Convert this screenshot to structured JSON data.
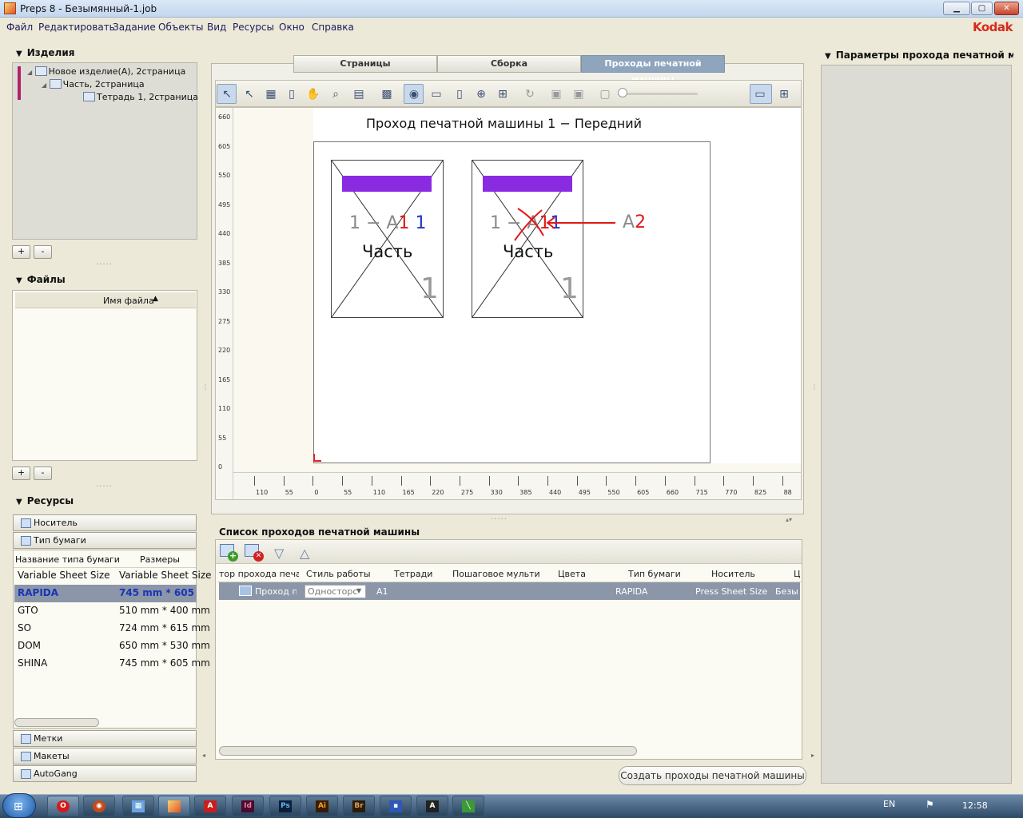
{
  "window": {
    "title": "Preps 8 - Безымянный-1.job"
  },
  "menu": [
    "Файл",
    "Редактировать",
    "Задание",
    "Объекты",
    "Вид",
    "Ресурсы",
    "Окно",
    "Справка"
  ],
  "brand": "Kodak",
  "products": {
    "title": "Изделия",
    "tree": [
      "Новое изделие(A), 2страница",
      "Часть, 2страница",
      "Тетрадь 1, 2страница"
    ],
    "add_label": "+",
    "remove_label": "-"
  },
  "files": {
    "title": "Файлы",
    "column": "Имя файла",
    "add_label": "+",
    "remove_label": "-"
  },
  "resources": {
    "title": "Ресурсы",
    "sections": [
      "Носитель",
      "Тип бумаги",
      "Метки",
      "Макеты",
      "AutoGang"
    ],
    "paper_columns": [
      "Название типа бумаги",
      "Размеры"
    ],
    "paper_types": [
      {
        "name": "Variable Sheet Size",
        "size": "Variable Sheet Size"
      },
      {
        "name": "RAPIDA",
        "size": "745 mm * 605 mm"
      },
      {
        "name": "GTO",
        "size": "510 mm * 400 mm"
      },
      {
        "name": "SO",
        "size": "724 mm * 615 mm"
      },
      {
        "name": "DOM",
        "size": "650 mm * 530 mm"
      },
      {
        "name": "SHINA",
        "size": "745 mm * 605 mm"
      }
    ],
    "selected_paper_index": 1
  },
  "tabs": [
    "Страницы",
    "Сборка",
    "Проходы печатной машины"
  ],
  "active_tab": 2,
  "canvas": {
    "heading": "Проход печатной машины 1 − Передний",
    "pages": [
      {
        "label_gray": "1 − A",
        "label_red": "1",
        "label_blue": "1",
        "part": "Часть",
        "number": "1"
      },
      {
        "label_gray": "1 − A",
        "label_red": "1",
        "label_blue": "1",
        "part": "Часть",
        "number": "1"
      }
    ],
    "annotation": {
      "prefix": "A",
      "value": "2"
    },
    "vertical_ruler": [
      "660",
      "605",
      "550",
      "495",
      "440",
      "385",
      "330",
      "275",
      "220",
      "165",
      "110",
      "55",
      "0"
    ],
    "horizontal_ruler": [
      "110",
      "55",
      "0",
      "55",
      "110",
      "165",
      "220",
      "275",
      "330",
      "385",
      "440",
      "495",
      "550",
      "605",
      "660",
      "715",
      "770",
      "825",
      "88"
    ]
  },
  "press_runs": {
    "title": "Список проходов печатной машины",
    "columns": [
      "тор прохода печати",
      "Стиль работы",
      "Тетради",
      "Пошаговое мульти",
      "Цвета",
      "Тип бумаги",
      "Носитель",
      "Ц"
    ],
    "rows": [
      {
        "name": "Проход пе",
        "style": "Односторс",
        "signatures": "A1",
        "step": "",
        "colors": "",
        "paper": "RAPIDA",
        "media": "Press Sheet Size",
        "extra": "Безы"
      }
    ],
    "create_button": "Создать проходы печатной машины"
  },
  "right_panel": {
    "title": "Параметры прохода печатной маши"
  },
  "taskbar": {
    "lang": "EN",
    "clock": "12:58"
  },
  "colors": {
    "accent": "#8ea5bd",
    "selected_row": "#8b96a8",
    "bar_purple": "#8a2be2",
    "annotation_red": "#e01818",
    "label_blue": "#2233cc"
  }
}
